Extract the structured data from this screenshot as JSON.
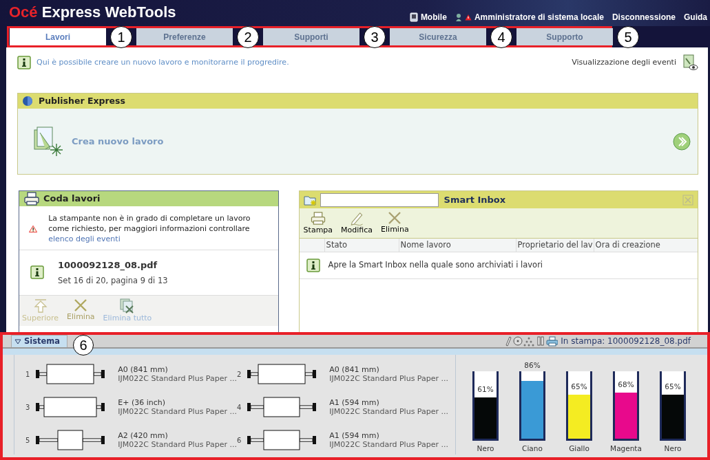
{
  "header": {
    "logo_brand": "Océ",
    "logo_product": "Express WebTools",
    "links": [
      {
        "kind": "mobile",
        "label": "Mobile"
      },
      {
        "kind": "user",
        "label": "Amministratore di sistema locale"
      },
      {
        "kind": "plain",
        "label": "Disconnessione"
      },
      {
        "kind": "plain",
        "label": "Guida"
      }
    ]
  },
  "tabs": [
    {
      "label": "Lavori",
      "selected": true,
      "callout": "1"
    },
    {
      "label": "Preferenze",
      "selected": false,
      "callout": "2"
    },
    {
      "label": "Supporti",
      "selected": false,
      "callout": "3"
    },
    {
      "label": "Sicurezza",
      "selected": false,
      "callout": "4"
    },
    {
      "label": "Supporto",
      "selected": false,
      "callout": "5"
    }
  ],
  "info": {
    "text": "Qui è possibile creare un nuovo lavoro e monitorarne il progredire.",
    "events_link": "Visualizzazione degli eventi"
  },
  "publisher": {
    "title": "Publisher Express",
    "action": "Crea nuovo lavoro"
  },
  "job_queue": {
    "title": "Coda lavori",
    "warning": "La stampante non è in grado di completare un lavoro come richiesto, per maggiori informazioni controllare",
    "warning_link": "elenco degli eventi",
    "job_name": "1000092128_08.pdf",
    "job_progress": "Set 16 di 20, pagina 9 di 13",
    "actions": [
      {
        "kind": "up",
        "label": "Superiore",
        "disabled": true
      },
      {
        "kind": "delete",
        "label": "Elimina",
        "disabled": false
      },
      {
        "kind": "delete_all",
        "label": "Elimina tutto",
        "disabled": true
      }
    ]
  },
  "smart_inbox": {
    "title": "Smart Inbox",
    "actions": [
      {
        "kind": "print",
        "label": "Stampa"
      },
      {
        "kind": "edit",
        "label": "Modifica"
      },
      {
        "kind": "delete",
        "label": "Elimina"
      }
    ],
    "columns": [
      "Stato",
      "Nome lavoro",
      "Proprietario del lav",
      "Ora di creazione"
    ],
    "message": "Apre la Smart Inbox nella quale sono archiviati i lavori"
  },
  "system": {
    "title": "Sistema",
    "callout": "6",
    "status": "In stampa: 1000092128_08.pdf",
    "rolls": [
      {
        "number": "1",
        "size": "A0 (841 mm)",
        "media": "IJM022C Standard Plus Paper ..."
      },
      {
        "number": "2",
        "size": "A0 (841 mm)",
        "media": "IJM022C Standard Plus Paper ..."
      },
      {
        "number": "3",
        "size": "E+ (36 inch)",
        "media": "IJM022C Standard Plus Paper ..."
      },
      {
        "number": "4",
        "size": "A1 (594 mm)",
        "media": "IJM022C Standard Plus Paper ..."
      },
      {
        "number": "5",
        "size": "A2 (420 mm)",
        "media": "IJM022C Standard Plus Paper ..."
      },
      {
        "number": "6",
        "size": "A1 (594 mm)",
        "media": "IJM022C Standard Plus Paper ..."
      }
    ],
    "inks": [
      {
        "name": "Nero",
        "reading": "61%",
        "level": 0.61,
        "color": "#050808"
      },
      {
        "name": "Ciano",
        "reading": "86%",
        "level": 0.86,
        "color": "#3a9ad6"
      },
      {
        "name": "Giallo",
        "reading": "65%",
        "level": 0.65,
        "color": "#f4ec22"
      },
      {
        "name": "Magenta",
        "reading": "68%",
        "level": 0.68,
        "color": "#e8098c"
      },
      {
        "name": "Nero",
        "reading": "65%",
        "level": 0.65,
        "color": "#050808"
      }
    ]
  }
}
